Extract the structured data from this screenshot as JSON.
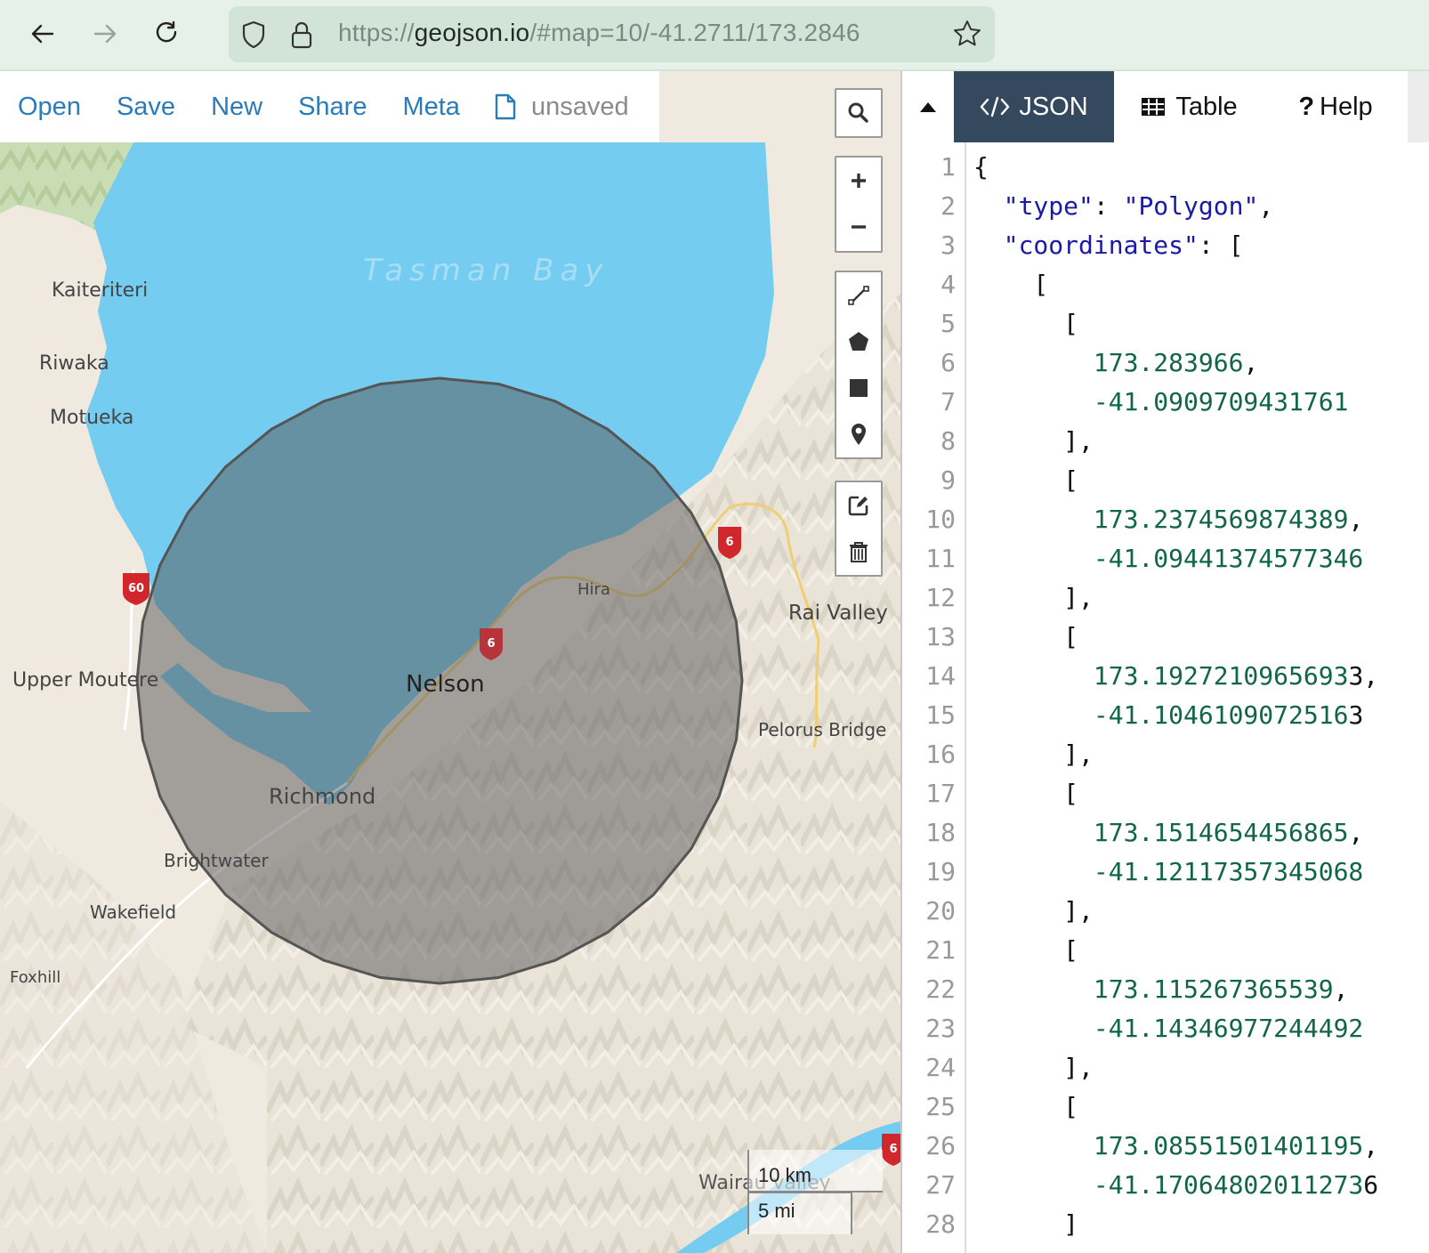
{
  "browser": {
    "url_scheme": "https://",
    "url_host": "geojson.io",
    "url_path": "/#map=10/-41.2711/173.2846",
    "icons": [
      "back-arrow-icon",
      "forward-arrow-icon",
      "reload-icon",
      "shield-icon",
      "lock-icon",
      "star-icon"
    ]
  },
  "topbar": {
    "links": [
      "Open",
      "Save",
      "New",
      "Share",
      "Meta"
    ],
    "file_status": "unsaved"
  },
  "map": {
    "water_label": "Tasman Bay",
    "places": [
      {
        "name": "Kaiteriteri"
      },
      {
        "name": "Riwaka"
      },
      {
        "name": "Motueka"
      },
      {
        "name": "Upper Moutere"
      },
      {
        "name": "Nelson"
      },
      {
        "name": "Richmond"
      },
      {
        "name": "Brightwater"
      },
      {
        "name": "Wakefield"
      },
      {
        "name": "Foxhill"
      },
      {
        "name": "Hira"
      },
      {
        "name": "Rai Valley"
      },
      {
        "name": "Pelorus Bridge"
      },
      {
        "name": "Wairau valley"
      }
    ],
    "road_shields": [
      "60",
      "6",
      "6",
      "6"
    ],
    "scale_km": "10 km",
    "scale_mi": "5 mi",
    "controls": {
      "search": "search-icon",
      "zoom": [
        "zoom-in-icon",
        "zoom-out-icon"
      ],
      "draw": [
        "draw-line-icon",
        "draw-polygon-icon",
        "draw-rectangle-icon",
        "draw-marker-icon"
      ],
      "edit": [
        "edit-icon",
        "trash-icon"
      ]
    },
    "colors": {
      "water": "#74cdf0",
      "land": "#efe9e0",
      "polygon_fill": "#555555",
      "polygon_stroke": "#555555"
    }
  },
  "pane": {
    "tabs": [
      {
        "label": "JSON",
        "active": true
      },
      {
        "label": "Table",
        "active": false
      },
      {
        "label": "Help",
        "active": false
      }
    ],
    "editor_lines": [
      {
        "n": "1",
        "parts": [
          [
            "p",
            "{"
          ]
        ]
      },
      {
        "n": "2",
        "parts": [
          [
            "p",
            "  "
          ],
          [
            "k",
            "\"type\""
          ],
          [
            "p",
            ": "
          ],
          [
            "s",
            "\"Polygon\""
          ],
          [
            "p",
            ","
          ]
        ]
      },
      {
        "n": "3",
        "parts": [
          [
            "p",
            "  "
          ],
          [
            "k",
            "\"coordinates\""
          ],
          [
            "p",
            ": ["
          ]
        ]
      },
      {
        "n": "4",
        "parts": [
          [
            "p",
            "    ["
          ]
        ]
      },
      {
        "n": "5",
        "parts": [
          [
            "p",
            "      ["
          ]
        ]
      },
      {
        "n": "6",
        "parts": [
          [
            "p",
            "        "
          ],
          [
            "n",
            "173.283966"
          ],
          [
            "p",
            ","
          ]
        ]
      },
      {
        "n": "7",
        "parts": [
          [
            "p",
            "        "
          ],
          [
            "n",
            "-41.0909709431761"
          ]
        ]
      },
      {
        "n": "8",
        "parts": [
          [
            "p",
            "      ],"
          ]
        ]
      },
      {
        "n": "9",
        "parts": [
          [
            "p",
            "      ["
          ]
        ]
      },
      {
        "n": "10",
        "parts": [
          [
            "p",
            "        "
          ],
          [
            "n",
            "173.2374569874389"
          ],
          [
            "p",
            ","
          ]
        ]
      },
      {
        "n": "11",
        "parts": [
          [
            "p",
            "        "
          ],
          [
            "n",
            "-41.09441374577346"
          ]
        ]
      },
      {
        "n": "12",
        "parts": [
          [
            "p",
            "      ],"
          ]
        ]
      },
      {
        "n": "13",
        "parts": [
          [
            "p",
            "      ["
          ]
        ]
      },
      {
        "n": "14",
        "parts": [
          [
            "p",
            "        "
          ],
          [
            "n",
            "173.1927210965693"
          ],
          [
            "p",
            "3,"
          ]
        ]
      },
      {
        "n": "15",
        "parts": [
          [
            "p",
            "        "
          ],
          [
            "n",
            "-41.1046109072516"
          ],
          [
            "p",
            "3"
          ]
        ]
      },
      {
        "n": "16",
        "parts": [
          [
            "p",
            "      ],"
          ]
        ]
      },
      {
        "n": "17",
        "parts": [
          [
            "p",
            "      ["
          ]
        ]
      },
      {
        "n": "18",
        "parts": [
          [
            "p",
            "        "
          ],
          [
            "n",
            "173.1514654456865"
          ],
          [
            "p",
            ","
          ]
        ]
      },
      {
        "n": "19",
        "parts": [
          [
            "p",
            "        "
          ],
          [
            "n",
            "-41.12117357345068"
          ]
        ]
      },
      {
        "n": "20",
        "parts": [
          [
            "p",
            "      ],"
          ]
        ]
      },
      {
        "n": "21",
        "parts": [
          [
            "p",
            "      ["
          ]
        ]
      },
      {
        "n": "22",
        "parts": [
          [
            "p",
            "        "
          ],
          [
            "n",
            "173.115267365539"
          ],
          [
            "p",
            ","
          ]
        ]
      },
      {
        "n": "23",
        "parts": [
          [
            "p",
            "        "
          ],
          [
            "n",
            "-41.14346977244492"
          ]
        ]
      },
      {
        "n": "24",
        "parts": [
          [
            "p",
            "      ],"
          ]
        ]
      },
      {
        "n": "25",
        "parts": [
          [
            "p",
            "      ["
          ]
        ]
      },
      {
        "n": "26",
        "parts": [
          [
            "p",
            "        "
          ],
          [
            "n",
            "173.08551501401195"
          ],
          [
            "p",
            ","
          ]
        ]
      },
      {
        "n": "27",
        "parts": [
          [
            "p",
            "        "
          ],
          [
            "n",
            "-41.17064802011273"
          ],
          [
            "p",
            "6"
          ]
        ]
      },
      {
        "n": "28",
        "parts": [
          [
            "p",
            "      ]"
          ]
        ]
      }
    ]
  }
}
